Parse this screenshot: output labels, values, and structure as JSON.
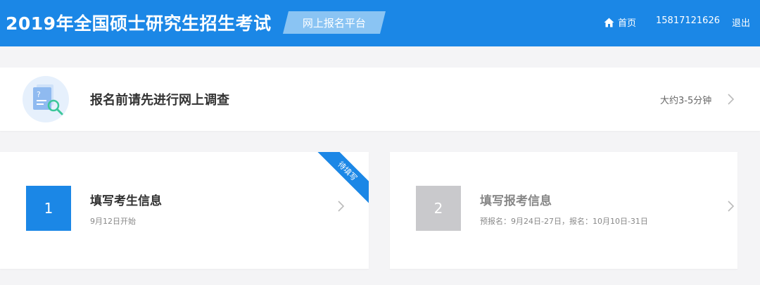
{
  "header": {
    "site_title": "2019年全国硕士研究生招生考试",
    "platform_badge": "网上报名平台",
    "nav": {
      "home_label": "首页",
      "home_icon": "home-icon",
      "phone": "15817121626",
      "logout_label": "退出"
    },
    "colors": {
      "brand": "#1b87e6",
      "badge": "#8ac4f3"
    }
  },
  "survey": {
    "icon": "survey-document-icon",
    "title": "报名前请先进行网上调查",
    "time_estimate": "大约3-5分钟"
  },
  "steps": [
    {
      "number": "1",
      "title": "填写考生信息",
      "subtitle": "9月12日开始",
      "ribbon": "待填写",
      "active": true
    },
    {
      "number": "2",
      "title": "填写报考信息",
      "subtitle": "预报名：9月24日-27日，报名：10月10日-31日",
      "active": false
    }
  ]
}
